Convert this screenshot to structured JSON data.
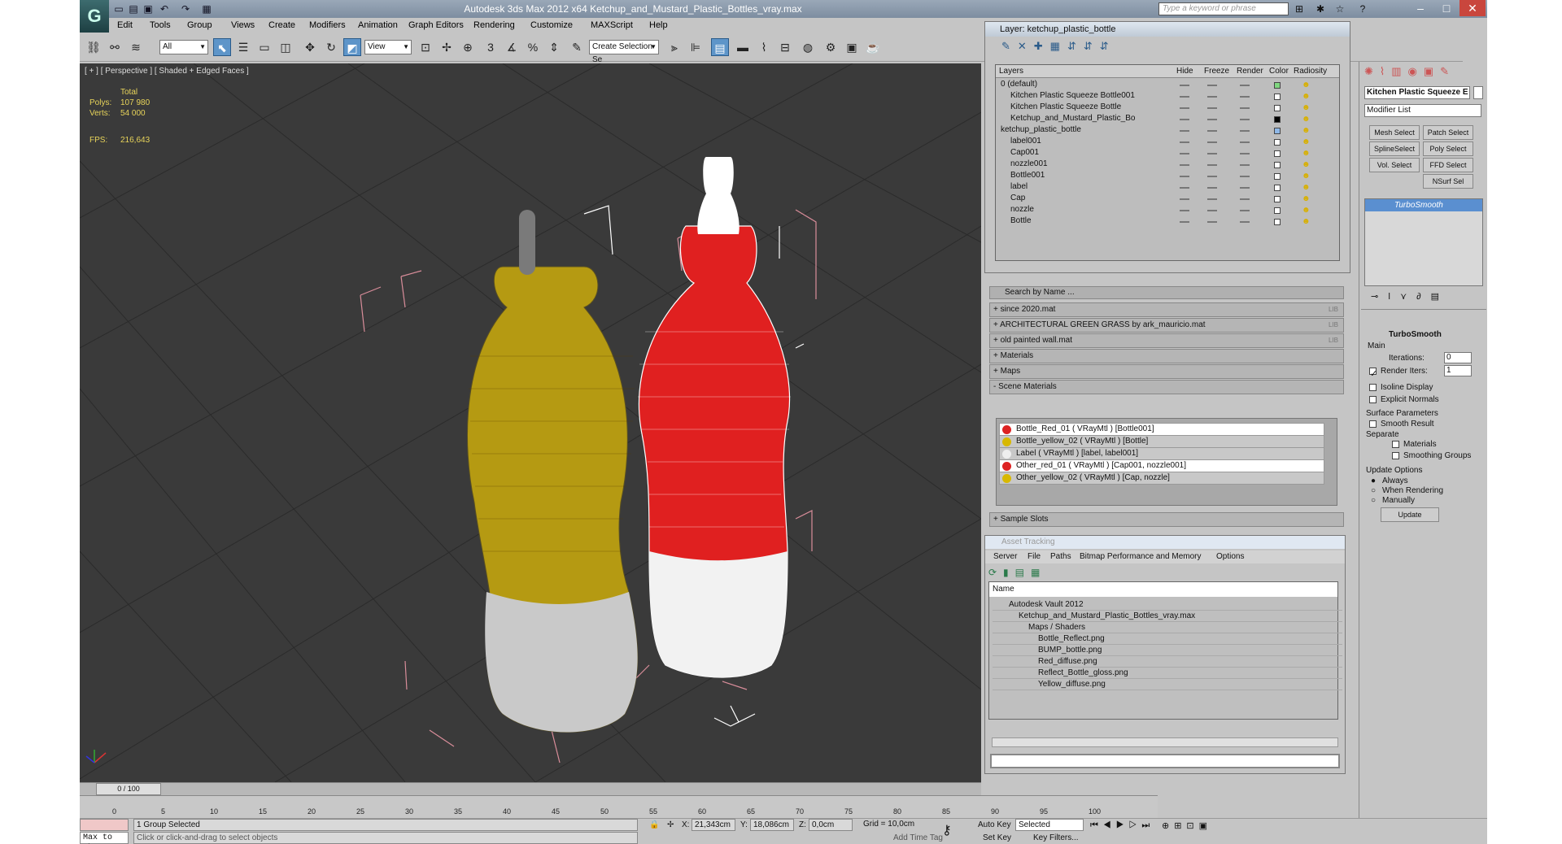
{
  "window": {
    "title": "Autodesk 3ds Max  2012 x64      Ketchup_and_Mustard_Plastic_Bottles_vray.max",
    "search_placeholder": "Type a keyword or phrase"
  },
  "menu": [
    "Edit",
    "Tools",
    "Group",
    "Views",
    "Create",
    "Modifiers",
    "Animation",
    "Graph Editors",
    "Rendering",
    "Customize",
    "MAXScript",
    "Help"
  ],
  "toolbar": {
    "filter": "All",
    "ref_coord": "View",
    "selection_set": "Create Selection Se"
  },
  "viewport": {
    "label": "[ + ] [ Perspective ] [ Shaded + Edged Faces ]",
    "total_label": "Total",
    "polys_label": "Polys:",
    "polys": "107 980",
    "verts_label": "Verts:",
    "verts": "54 000",
    "fps_label": "FPS:",
    "fps": "216,643"
  },
  "layers": {
    "title": "Layer: ketchup_plastic_bottle",
    "columns": [
      "Layers",
      "Hide",
      "Freeze",
      "Render",
      "Color",
      "Radiosity"
    ],
    "rows": [
      {
        "name": "0 (default)",
        "indent": 0,
        "color": "#7fd67f"
      },
      {
        "name": "Kitchen Plastic Squeeze Bottle001",
        "indent": 1,
        "color": "#ffffff"
      },
      {
        "name": "Kitchen Plastic Squeeze Bottle",
        "indent": 1,
        "color": "#ffffff"
      },
      {
        "name": "Ketchup_and_Mustard_Plastic_Bo",
        "indent": 1,
        "color": "#000000"
      },
      {
        "name": "ketchup_plastic_bottle",
        "indent": 0,
        "color": "#8fb8e8"
      },
      {
        "name": "label001",
        "indent": 1,
        "color": "#ffffff"
      },
      {
        "name": "Cap001",
        "indent": 1,
        "color": "#ffffff"
      },
      {
        "name": "nozzle001",
        "indent": 1,
        "color": "#ffffff"
      },
      {
        "name": "Bottle001",
        "indent": 1,
        "color": "#ffffff"
      },
      {
        "name": "label",
        "indent": 1,
        "color": "#ffffff"
      },
      {
        "name": "Cap",
        "indent": 1,
        "color": "#ffffff"
      },
      {
        "name": "nozzle",
        "indent": 1,
        "color": "#ffffff"
      },
      {
        "name": "Bottle",
        "indent": 1,
        "color": "#ffffff"
      }
    ]
  },
  "materials": {
    "search": "Search by Name ...",
    "libraries": [
      {
        "label": "+ since 2020.mat",
        "tag": "LIB"
      },
      {
        "label": "+ ARCHITECTURAL GREEN GRASS by ark_mauricio.mat",
        "tag": "LIB"
      },
      {
        "label": "+ old painted wall.mat",
        "tag": "LIB"
      },
      {
        "label": "+ Materials",
        "tag": ""
      },
      {
        "label": "+ Maps",
        "tag": ""
      },
      {
        "label": "- Scene Materials",
        "tag": ""
      }
    ],
    "scene": [
      {
        "label": "Bottle_Red_01  ( VRayMtl ) [Bottle001]",
        "color": "#d22"
      },
      {
        "label": "Bottle_yellow_02  ( VRayMtl ) [Bottle]",
        "color": "#d8b800"
      },
      {
        "label": "Label  ( VRayMtl ) [label, label001]",
        "color": "#eee"
      },
      {
        "label": "Other_red_01  ( VRayMtl ) [Cap001, nozzle001]",
        "color": "#d22"
      },
      {
        "label": "Other_yellow_02  ( VRayMtl ) [Cap, nozzle]",
        "color": "#d8b800"
      }
    ],
    "sample": "+ Sample Slots"
  },
  "asset": {
    "title": "Asset Tracking",
    "menu": [
      "Server",
      "File",
      "Paths",
      "Bitmap Performance and Memory",
      "Options"
    ],
    "header": "Name",
    "rows": [
      {
        "name": "Autodesk Vault 2012",
        "indent": 0
      },
      {
        "name": "Ketchup_and_Mustard_Plastic_Bottles_vray.max",
        "indent": 1
      },
      {
        "name": "Maps / Shaders",
        "indent": 2
      },
      {
        "name": "Bottle_Reflect.png",
        "indent": 3
      },
      {
        "name": "BUMP_bottle.png",
        "indent": 3
      },
      {
        "name": "Red_diffuse.png",
        "indent": 3
      },
      {
        "name": "Reflect_Bottle_gloss.png",
        "indent": 3
      },
      {
        "name": "Yellow_diffuse.png",
        "indent": 3
      }
    ]
  },
  "command": {
    "object_name": "Kitchen Plastic Squeeze E",
    "modifier_list": "Modifier List",
    "buttons": [
      "Mesh Select",
      "Patch Select",
      "SplineSelect",
      "Poly Select",
      "Vol. Select",
      "FFD Select",
      "NSurf Sel"
    ],
    "stack_item": "TurboSmooth",
    "rollout": "TurboSmooth",
    "main": "Main",
    "iterations_label": "Iterations:",
    "iterations": "0",
    "render_iters_label": "Render Iters:",
    "render_iters": "1",
    "isoline": "Isoline Display",
    "explicit": "Explicit Normals",
    "surface": "Surface Parameters",
    "smooth": "Smooth Result",
    "separate": "Separate",
    "materials": "Materials",
    "smoothing": "Smoothing Groups",
    "update_options": "Update Options",
    "always": "Always",
    "when_rendering": "When Rendering",
    "manually": "Manually",
    "update": "Update"
  },
  "timeline": {
    "frame": "0 / 100",
    "ticks": [
      "0",
      "5",
      "10",
      "15",
      "20",
      "25",
      "30",
      "35",
      "40",
      "45",
      "50",
      "55",
      "60",
      "65",
      "70",
      "75",
      "80",
      "85",
      "90",
      "95",
      "100"
    ]
  },
  "status": {
    "maxscript": "Max to Physc",
    "selected": "1 Group Selected",
    "prompt": "Click or click-and-drag to select objects",
    "x_label": "X:",
    "x": "21,343cm",
    "y_label": "Y:",
    "y": "18,086cm",
    "z_label": "Z:",
    "z": "0,0cm",
    "grid": "Grid = 10,0cm",
    "autokey": "Auto Key",
    "selected_dd": "Selected",
    "setkey": "Set Key",
    "keyfilters": "Key Filters...",
    "addtime": "Add Time Tag"
  }
}
